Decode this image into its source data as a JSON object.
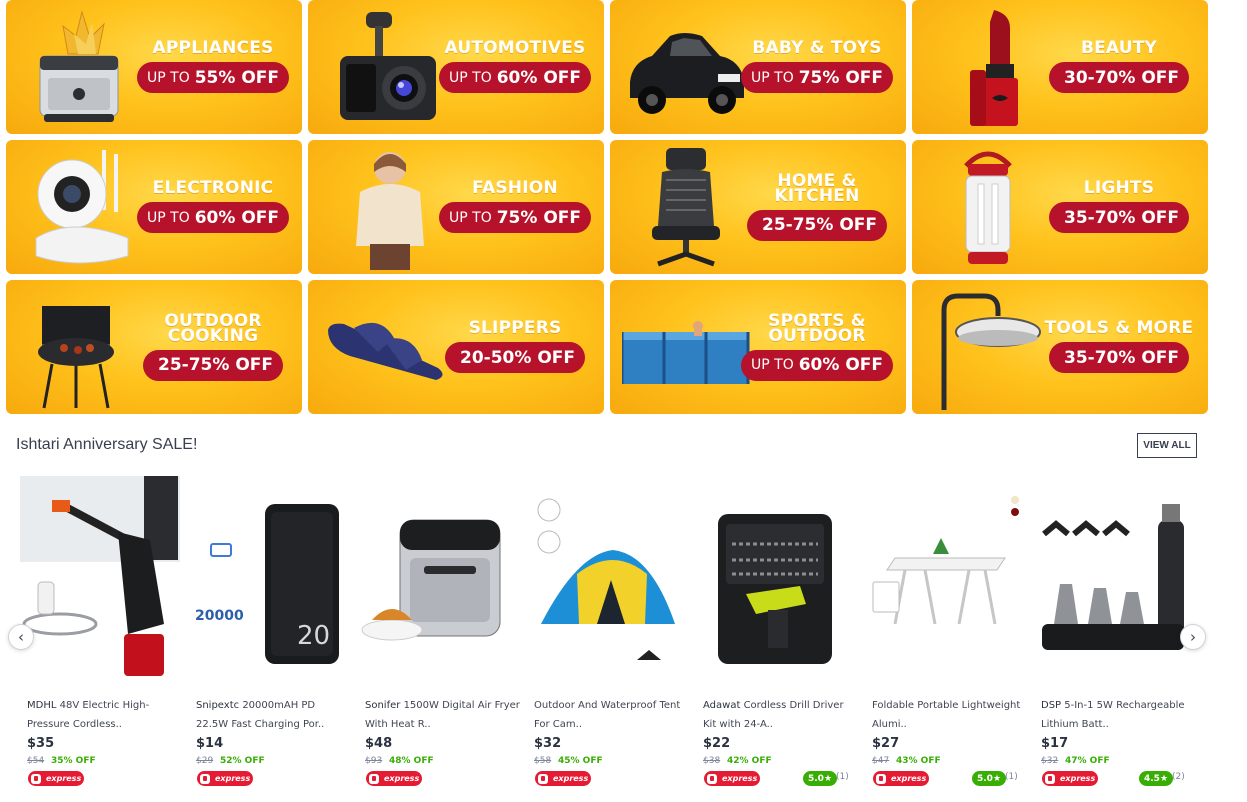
{
  "categories": [
    {
      "name": "APPLIANCES",
      "pre": "UP TO",
      "value": "55% OFF"
    },
    {
      "name": "AUTOMOTIVES",
      "pre": "UP TO",
      "value": "60% OFF"
    },
    {
      "name": "BABY & TOYS",
      "pre": "UP TO",
      "value": "75% OFF"
    },
    {
      "name": "BEAUTY",
      "pre": "",
      "value": "30-70% OFF"
    },
    {
      "name": "ELECTRONIC",
      "pre": "UP TO",
      "value": "60% OFF"
    },
    {
      "name": "FASHION",
      "pre": "UP TO",
      "value": "75% OFF"
    },
    {
      "name": "HOME & KITCHEN",
      "pre": "",
      "value": "25-75% OFF"
    },
    {
      "name": "LIGHTS",
      "pre": "",
      "value": "35-70% OFF"
    },
    {
      "name": "OUTDOOR COOKING",
      "pre": "",
      "value": "25-75% OFF"
    },
    {
      "name": "SLIPPERS",
      "pre": "",
      "value": "20-50% OFF"
    },
    {
      "name": "SPORTS & OUTDOOR",
      "pre": "UP TO",
      "value": "60% OFF"
    },
    {
      "name": "TOOLS & MORE",
      "pre": "",
      "value": "35-70% OFF"
    }
  ],
  "sale": {
    "title": "Ishtari Anniversary SALE!",
    "view_all": "VIEW ALL",
    "express_label": "express",
    "products": [
      {
        "brand": "MDHL",
        "line1": "48V Electric High-",
        "line2": "Pressure Cordless..",
        "price": "$35",
        "old": "$54",
        "off": "35% OFF",
        "rating": "",
        "count": ""
      },
      {
        "brand": "Snipextc",
        "line1": "20000mAH PD",
        "line2": "22.5W Fast Charging Por..",
        "price": "$14",
        "old": "$29",
        "off": "52% OFF",
        "rating": "",
        "count": ""
      },
      {
        "brand": "Sonifer",
        "line1": "1500W Digital Air Fryer",
        "line2": "With Heat R..",
        "price": "$48",
        "old": "$93",
        "off": "48% OFF",
        "rating": "",
        "count": ""
      },
      {
        "brand": "",
        "line1": "Outdoor And Waterproof Tent",
        "line2": "For Cam..",
        "price": "$32",
        "old": "$58",
        "off": "45% OFF",
        "rating": "",
        "count": ""
      },
      {
        "brand": "Adawat",
        "line1": "Cordless Drill Driver",
        "line2": "Kit with 24-A..",
        "price": "$22",
        "old": "$38",
        "off": "42% OFF",
        "rating": "5.0★",
        "count": "(1)"
      },
      {
        "brand": "",
        "line1": "Foldable Portable Lightweight",
        "line2": "Alumi..",
        "price": "$27",
        "old": "$47",
        "off": "43% OFF",
        "rating": "5.0★",
        "count": "(1)"
      },
      {
        "brand": "DSP",
        "line1": "5-In-1 5W Rechargeable",
        "line2": "Lithium Batt..",
        "price": "$17",
        "old": "$32",
        "off": "47% OFF",
        "rating": "4.5★",
        "count": "(2)"
      }
    ]
  },
  "icons": {
    "prev": "chevron-left-icon",
    "next": "chevron-right-icon"
  },
  "colors": {
    "tile": "#ffc21c",
    "pill": "#b6122b",
    "express": "#e51b33",
    "rating": "#38ae04"
  }
}
